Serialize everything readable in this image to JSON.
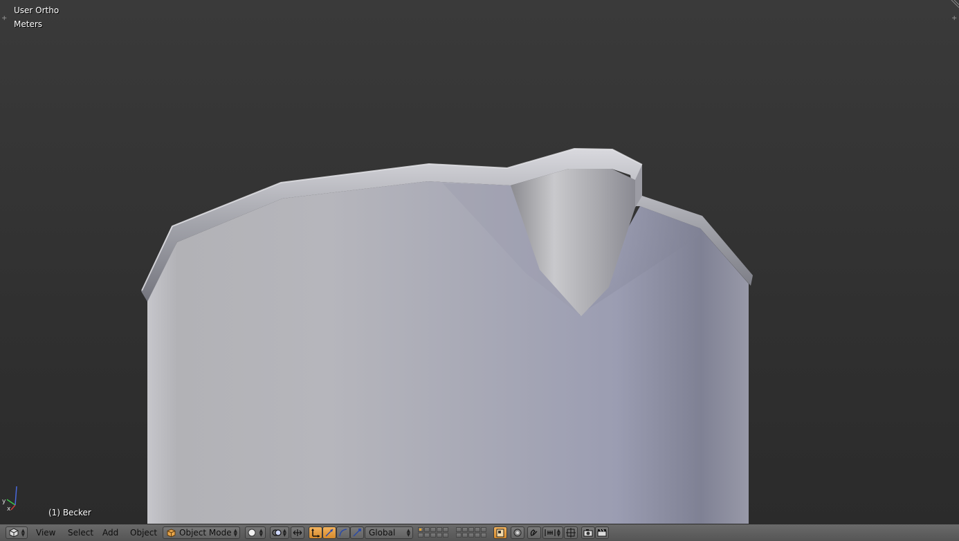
{
  "viewport": {
    "view_name": "User Ortho",
    "units": "Meters",
    "active_object": "(1) Becker",
    "axis_labels": {
      "x": "x",
      "y": "y"
    }
  },
  "header": {
    "editor_icon": "3d-view-cube-icon",
    "menus": [
      "View",
      "Select",
      "Add",
      "Object"
    ],
    "mode": "Object Mode",
    "orientation": "Global"
  },
  "colors": {
    "viewport_bg": "#393939",
    "header_bg": "#5f5f5f",
    "active_accent": "#e79a3a",
    "mesh_light": "#bdbec6",
    "mesh_dark": "#7d7f8f"
  }
}
